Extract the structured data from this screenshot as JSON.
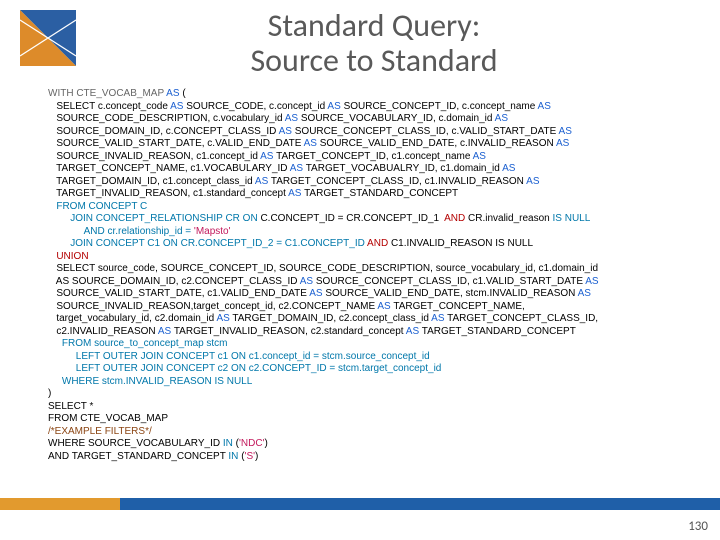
{
  "title": {
    "line1": "Standard Query:",
    "line2": "Source to Standard"
  },
  "page_number": "130",
  "sql": {
    "with": "WITH CTE_VOCAB_MAP",
    "as": " AS ",
    "open": "(",
    "sel_indent": "   SELECT c.concept_code",
    "as1": " AS ",
    "t1": "SOURCE_CODE, c.concept_id",
    "as2": " AS ",
    "t2": "SOURCE_CONCEPT_ID, c.concept_name",
    "l2": "   SOURCE_CODE_DESCRIPTION, c.vocabulary_id",
    "as3": " AS ",
    "t3": "SOURCE_VOCABULARY_ID, c.domain_id",
    "as4": " AS",
    "l3": "   SOURCE_DOMAIN_ID, c.CONCEPT_CLASS_ID",
    "as5": " AS ",
    "t4": "SOURCE_CONCEPT_CLASS_ID, c.VALID_START_DATE",
    "l4": "   SOURCE_VALID_START_DATE, c.VALID_END_DATE",
    "as6": " AS ",
    "t5": "SOURCE_VALID_END_DATE, c.INVALID_REASON",
    "l5": "   SOURCE_INVALID_REASON, c1.concept_id",
    "as7": " AS ",
    "t6": "TARGET_CONCEPT_ID, c1.concept_name",
    "l6": "   TARGET_CONCEPT_NAME, c1.VOCABULARY_ID",
    "as8": " AS ",
    "t7": "TARGET_VOCABUALRY_ID, c1.domain_id",
    "l7": "   TARGET_DOMAIN_ID, c1.concept_class_id",
    "as9": " AS ",
    "t8": "TARGET_CONCEPT_CLASS_ID, c1.INVALID_REASON",
    "l8": "   TARGET_INVALID_REASON, c1.standard_concept",
    "as10": " AS ",
    "t9": "TARGET_STANDARD_CONCEPT",
    "from1": "   FROM CONCEPT C",
    "join1a": "        JOIN CONCEPT_RELATIONSHIP CR",
    "on": " ON ",
    "join1b": "C.CONCEPT_ID = CR.CONCEPT_ID_1 ",
    "and1": " AND ",
    "join1c": "CR.invalid_reason",
    "isnull": " IS NULL",
    "join_rel": "             AND cr.relationship_id = ",
    "mapsto": "'Mapsto'",
    "join2": "        JOIN CONCEPT C1 ON CR.CONCEPT_ID_2 = C1.CONCEPT_ID",
    "and2": " AND ",
    "join2b": "C1.INVALID_REASON IS NULL",
    "union": "   UNION",
    "sel2": "   SELECT source_code, SOURCE_CONCEPT_ID, SOURCE_CODE_DESCRIPTION, source_vocabulary_id, c1.domain_id",
    "sel2b": "   AS SOURCE_DOMAIN_ID, c2.CONCEPT_CLASS_ID",
    "as11": " AS ",
    "t10": "SOURCE_CONCEPT_CLASS_ID, c1.VALID_START_DATE",
    "sel2c": "   SOURCE_VALID_START_DATE, c1.VALID_END_DATE",
    "as12": " AS ",
    "t11": "SOURCE_VALID_END_DATE, stcm.INVALID_REASON",
    "sel2d": "   SOURCE_INVALID_REASON,target_concept_id, c2.CONCEPT_NAME",
    "as13": " AS ",
    "t12": "TARGET_CONCEPT_NAME,",
    "sel2e": "   target_vocabulary_id, c2.domain_id",
    "as14": " AS ",
    "t13": "TARGET_DOMAIN_ID, c2.concept_class_id",
    "as15": " AS ",
    "t14": "TARGET_CONCEPT_CLASS_ID,",
    "sel2f": "   c2.INVALID_REASON",
    "as16": " AS ",
    "t15": "TARGET_INVALID_REASON, c2.standard_concept",
    "as17": " AS ",
    "t16": "TARGET_STANDARD_CONCEPT",
    "from2": "     FROM source_to_concept_map stcm",
    "loj1": "          LEFT OUTER JOIN CONCEPT c1 ON c1.concept_id = stcm.source_concept_id",
    "loj2": "          LEFT OUTER JOIN CONCEPT c2 ON c2.CONCEPT_ID = stcm.target_concept_id",
    "where1": "     WHERE stcm.INVALID_REASON",
    "isnull2": " IS NULL",
    "close_paren": ")",
    "sel_final": "SELECT *",
    "from_final": "FROM CTE_VOCAB_MAP",
    "comment": "/*EXAMPLE FILTERS*/",
    "where2": "WHERE SOURCE_VOCABULARY_ID",
    "in": " IN ",
    "ndc_open": "(",
    "ndc": "'NDC'",
    "ndc_close": ")",
    "and_final": "AND TARGET_STANDARD_CONCEPT",
    "in2": " IN ",
    "s_open": "(",
    "s": "'S'",
    "s_close": ")"
  }
}
